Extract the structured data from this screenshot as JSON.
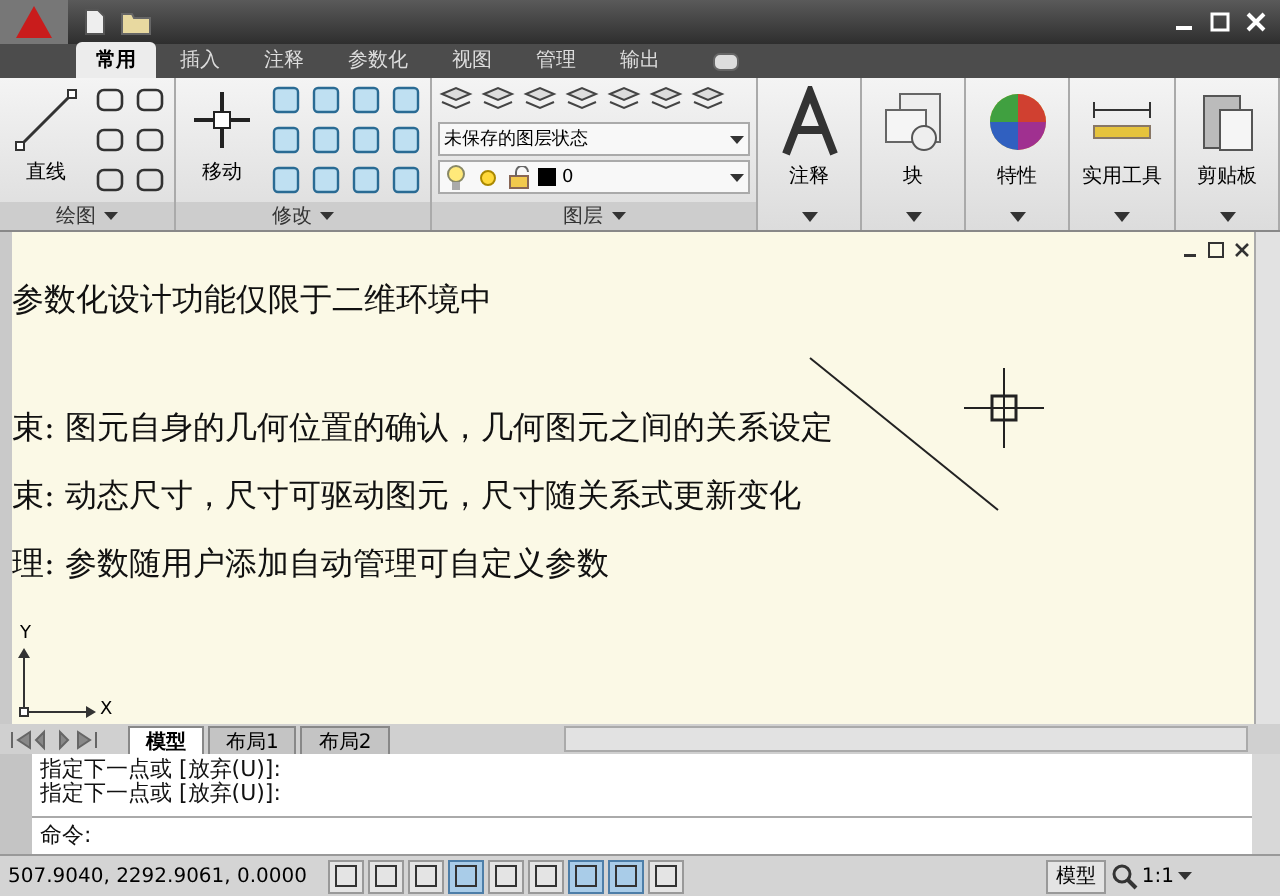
{
  "ribbon": {
    "tabs": [
      {
        "label": "常用",
        "selected": true
      },
      {
        "label": "插入",
        "selected": false
      },
      {
        "label": "注释",
        "selected": false
      },
      {
        "label": "参数化",
        "selected": false
      },
      {
        "label": "视图",
        "selected": false
      },
      {
        "label": "管理",
        "selected": false
      },
      {
        "label": "输出",
        "selected": false
      }
    ],
    "draw_panel": {
      "big_button": "直线",
      "title": "绘图"
    },
    "modify_panel": {
      "big_button": "移动",
      "title": "修改"
    },
    "layers_panel": {
      "state_combo": "未保存的图层状态",
      "layer_combo": "0",
      "title": "图层"
    },
    "big_panels": [
      {
        "label": "注释",
        "kind": "text"
      },
      {
        "label": "块",
        "kind": "block"
      },
      {
        "label": "特性",
        "kind": "wheel"
      },
      {
        "label": "实用工具",
        "kind": "ruler"
      },
      {
        "label": "剪贴板",
        "kind": "clipboard"
      }
    ]
  },
  "canvas": {
    "text_lines": [
      "参数化设计功能仅限于二维环境中",
      "束: 图元自身的几何位置的确认，几何图元之间的关系设定",
      "束: 动态尺寸，尺寸可驱动图元，尺寸随关系式更新变化",
      "理: 参数随用户添加自动管理可自定义参数"
    ],
    "ucs_labels": [
      "Y",
      "X"
    ]
  },
  "layout_tabs": [
    {
      "label": "模型",
      "selected": true
    },
    {
      "label": "布局1",
      "selected": false
    },
    {
      "label": "布局2",
      "selected": false
    }
  ],
  "command": {
    "history": [
      "指定下一点或 [放弃(U)]:",
      "指定下一点或 [放弃(U)]:"
    ],
    "prompt": "命令:"
  },
  "status_bar": {
    "coordinates": "507.9040, 2292.9061, 0.0000",
    "toggles": [
      {
        "on": false
      },
      {
        "on": false
      },
      {
        "on": false
      },
      {
        "on": true
      },
      {
        "on": false
      },
      {
        "on": false
      },
      {
        "on": true
      },
      {
        "on": true
      },
      {
        "on": false
      }
    ],
    "model_button": "模型",
    "scale": "1:1"
  }
}
